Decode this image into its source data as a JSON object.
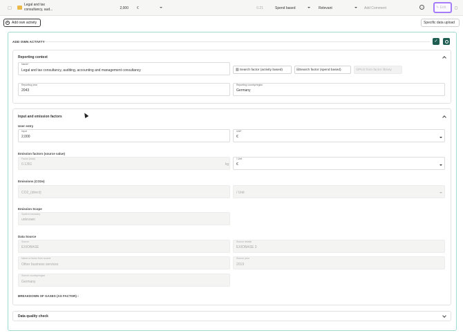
{
  "activity_row": {
    "name": "Legal and tax consultancy, aud...",
    "value": "2,000",
    "currency": "€",
    "factor": "0.21",
    "method": "Spend based",
    "relevance": "Relevant",
    "comment_placeholder": "Add Comment",
    "edit_label": "Edit"
  },
  "toolbar": {
    "add_label": "Add own activity",
    "upload_label": "Specific data upload"
  },
  "form": {
    "title": "ADD OWN ACTIVITY",
    "reporting_context": {
      "title": "Reporting context",
      "name_label": "Name*",
      "name_value": "Legal and tax consultancy, auditing, accounting and management consultancy",
      "search_activity": "Search factor (activity based)",
      "search_spend": "Search factor (spend based)",
      "pick_library": "Pick from factor library",
      "year_label": "Reporting year",
      "year_value": "2043",
      "country_label": "Reporting country/region",
      "country_value": "Germany"
    },
    "input_emission": {
      "title": "Input and emission factors",
      "user_entry": "User entry",
      "input_label": "Input",
      "input_value": "2,000",
      "unit_label": "Unit*",
      "unit_value": "€",
      "ef_title": "Emission factors (source value)",
      "factor_label": "Factor (total)",
      "factor_value": "0.1351",
      "factor_unit": "kg",
      "per_unit_label": "/ Unit",
      "per_unit_value": "€",
      "emissions_title": "Emissions (CO2e)",
      "emission_value": "CO2_(direct)",
      "emission_unit_placeholder": "/ Unit",
      "scope_title": "Emission Scope",
      "boundary_label": "System boundary",
      "boundary_value": "unknown",
      "datasource_title": "Data Source",
      "source_label": "Source",
      "source_value": "EXIOBASE",
      "source_details_label": "Source details",
      "source_details_value": "EXIOBASE 3",
      "factor_name_label": "Name of factor from source",
      "factor_name_value": "Other business services",
      "source_year_label": "Source year",
      "source_year_value": "2019",
      "source_country_label": "Source country/region",
      "source_country_value": "Germany",
      "breakdown_label": "BREAKDOWN OF GASES (AS FACTOR)"
    },
    "quality": {
      "title": "Data quality check"
    }
  },
  "icons": [
    "folder-icon",
    "more-icon",
    "edit-icon",
    "trash-icon",
    "add-icon",
    "check-icon",
    "cancel-icon",
    "chart-icon",
    "spend-icon",
    "library-icon",
    "chevron-up-icon",
    "chevron-down-icon",
    "chevron-right-icon"
  ]
}
